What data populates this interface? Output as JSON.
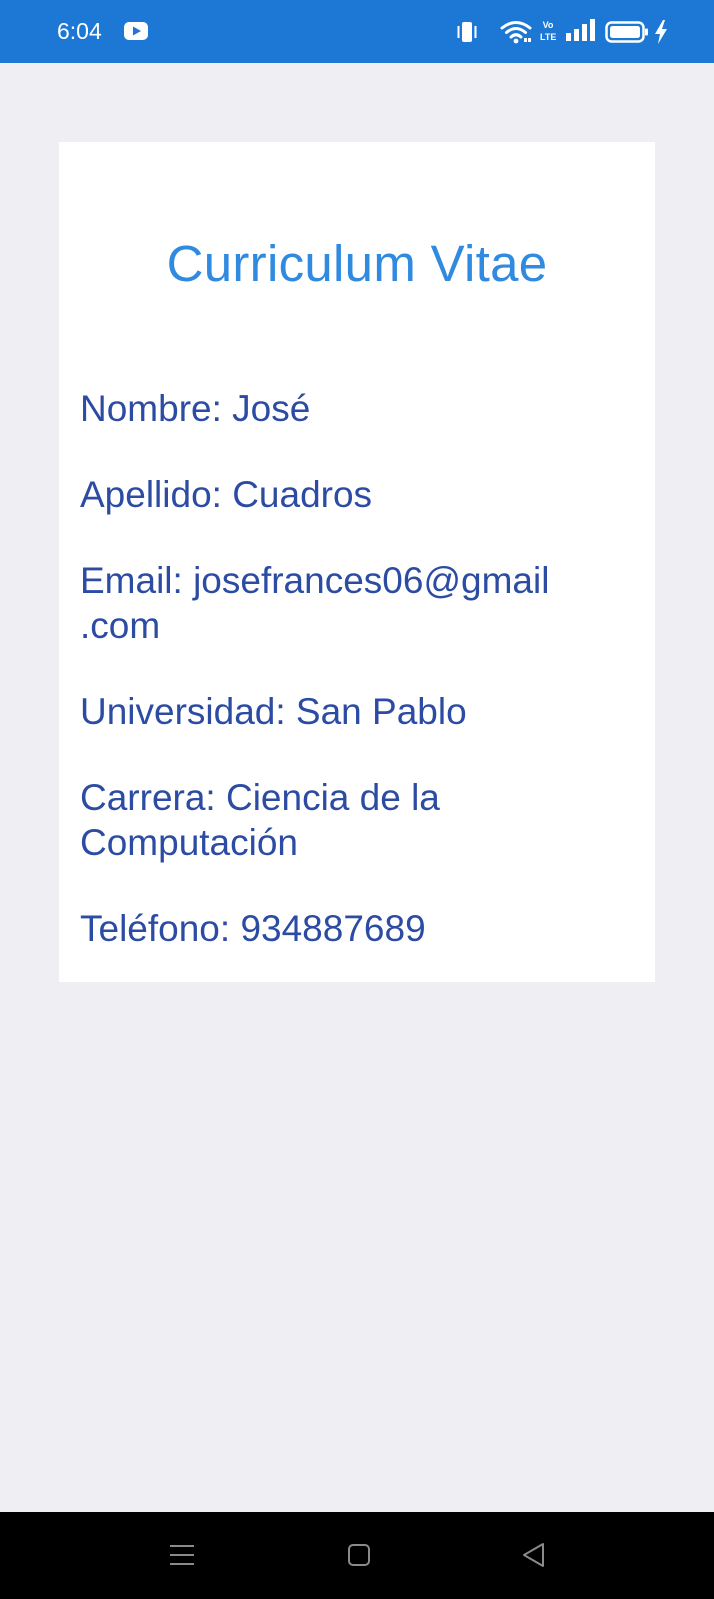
{
  "status_bar": {
    "time": "6:04",
    "icons": [
      "youtube-icon",
      "vibrate-icon",
      "wifi-icon",
      "volte-icon",
      "signal-icon",
      "battery-icon",
      "charging-icon"
    ],
    "volte_label": "Vo LTE",
    "background_color": "#1c78d4"
  },
  "card": {
    "title": "Curriculum Vitae",
    "fields": [
      {
        "text": "Nombre: José"
      },
      {
        "text": "Apellido: Cuadros"
      },
      {
        "text_line1": "Email: josefrances06@gmail",
        "text_line2": ".com"
      },
      {
        "text": "Universidad: San Pablo"
      },
      {
        "text_line1": "Carrera: Ciencia de la",
        "text_line2": "Computación"
      },
      {
        "text": "Teléfono: 934887689"
      }
    ],
    "title_color": "#2f8ae0",
    "text_color": "#2c4ba3"
  },
  "nav_bar": {
    "icons": [
      "menu-icon",
      "home-icon",
      "back-icon"
    ]
  }
}
